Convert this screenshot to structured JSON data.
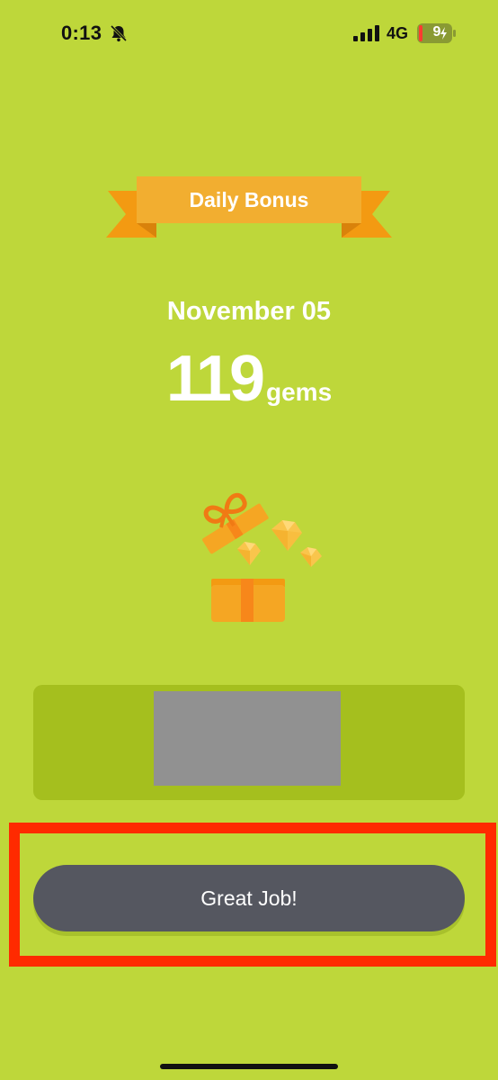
{
  "status_bar": {
    "time": "0:13",
    "network": "4G",
    "battery_level": "9",
    "icons": [
      "bell-off-icon",
      "signal-icon",
      "battery-charging-icon"
    ]
  },
  "bonus": {
    "banner_title": "Daily Bonus",
    "date": "November 05",
    "gem_count": "119",
    "gem_unit": "gems"
  },
  "actions": {
    "primary_button_label": "Great Job!"
  },
  "colors": {
    "background": "#bed73a",
    "banner": "#f2ae30",
    "banner_ribbon": "#f39a12",
    "button": "#555760",
    "highlight": "#ff2a00",
    "ad_slot": "#a5bf1e"
  }
}
